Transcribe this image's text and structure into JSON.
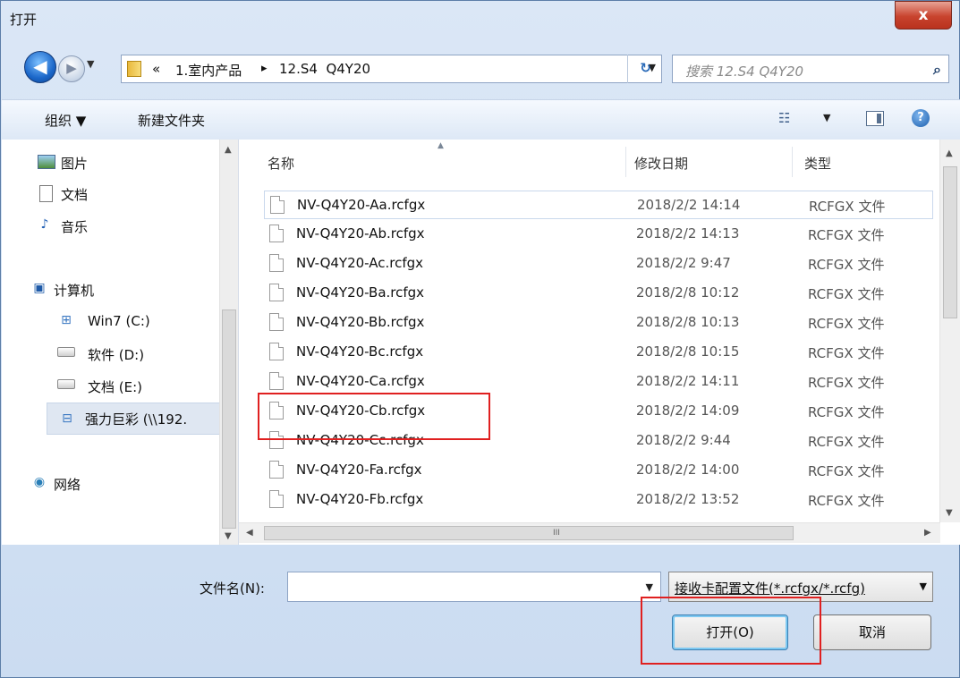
{
  "window": {
    "title": "打开",
    "close_label": "x"
  },
  "nav_buttons": {
    "back": "◀",
    "forward": "▶",
    "recent_dropdown": "▼"
  },
  "address": {
    "prefix": "«",
    "crumbs": [
      "1.室内产品",
      "12.S4  Q4Y20"
    ],
    "separator": "▸",
    "dropdown": "▼",
    "refresh": "↻"
  },
  "search": {
    "placeholder": "搜索 12.S4  Q4Y20",
    "icon": "search-icon"
  },
  "toolbar": {
    "organize": "组织 ▼",
    "new_folder": "新建文件夹",
    "view_dropdown": "▼",
    "help": "?"
  },
  "nav_pane": {
    "items": [
      {
        "label": "图片",
        "icon": "pictures-icon"
      },
      {
        "label": "文档",
        "icon": "documents-icon"
      },
      {
        "label": "音乐",
        "icon": "music-icon"
      },
      {
        "label": "计算机",
        "icon": "computer-icon"
      },
      {
        "label": "Win7 (C:)",
        "icon": "windows-drive-icon"
      },
      {
        "label": "软件 (D:)",
        "icon": "drive-icon"
      },
      {
        "label": "文档 (E:)",
        "icon": "drive-icon"
      },
      {
        "label": "强力巨彩 (\\\\192.",
        "icon": "network-drive-icon"
      },
      {
        "label": "网络",
        "icon": "network-icon"
      }
    ]
  },
  "file_list": {
    "columns": [
      "名称",
      "修改日期",
      "类型"
    ],
    "rows": [
      {
        "name": "NV-Q4Y20-Aa.rcfgx",
        "date": "2018/2/2 14:14",
        "type": "RCFGX 文件"
      },
      {
        "name": "NV-Q4Y20-Ab.rcfgx",
        "date": "2018/2/2 14:13",
        "type": "RCFGX 文件"
      },
      {
        "name": "NV-Q4Y20-Ac.rcfgx",
        "date": "2018/2/2 9:47",
        "type": "RCFGX 文件"
      },
      {
        "name": "NV-Q4Y20-Ba.rcfgx",
        "date": "2018/2/8 10:12",
        "type": "RCFGX 文件"
      },
      {
        "name": "NV-Q4Y20-Bb.rcfgx",
        "date": "2018/2/8 10:13",
        "type": "RCFGX 文件"
      },
      {
        "name": "NV-Q4Y20-Bc.rcfgx",
        "date": "2018/2/8 10:15",
        "type": "RCFGX 文件"
      },
      {
        "name": "NV-Q4Y20-Ca.rcfgx",
        "date": "2018/2/2 14:11",
        "type": "RCFGX 文件"
      },
      {
        "name": "NV-Q4Y20-Cb.rcfgx",
        "date": "2018/2/2 14:09",
        "type": "RCFGX 文件"
      },
      {
        "name": "NV-Q4Y20-Cc.rcfgx",
        "date": "2018/2/2 9:44",
        "type": "RCFGX 文件"
      },
      {
        "name": "NV-Q4Y20-Fa.rcfgx",
        "date": "2018/2/2 14:00",
        "type": "RCFGX 文件"
      },
      {
        "name": "NV-Q4Y20-Fb.rcfgx",
        "date": "2018/2/2 13:52",
        "type": "RCFGX 文件"
      }
    ]
  },
  "scroll": {
    "hscroll_grip": "III"
  },
  "bottom": {
    "filename_label": "文件名(N):",
    "filename_value": "",
    "filename_dropdown": "▼",
    "filter_value": "接收卡配置文件(*.rcfgx/*.rcfg)",
    "filter_dropdown": "▼",
    "open_button": "打开(O)",
    "cancel_button": "取消"
  },
  "colors": {
    "highlight": "#e02020",
    "accent": "#1b67c9"
  }
}
